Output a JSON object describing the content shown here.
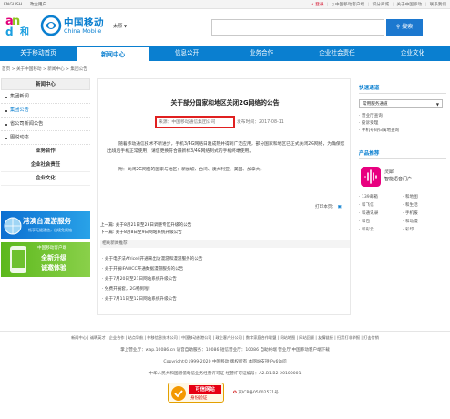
{
  "topbar": {
    "english": "ENGLISH",
    "portal": "政企用户",
    "login": "登录",
    "client": "中国移动客户端",
    "points": "积分商城",
    "about": "关于中国移动",
    "contact": "联系我们"
  },
  "header": {
    "brand_cn": "中国移动",
    "brand_en": "China Mobile",
    "region": "太原",
    "search_placeholder": "",
    "search_button": "搜索"
  },
  "nav": {
    "items": [
      {
        "label": "关于移动首页",
        "active": false
      },
      {
        "label": "新闻中心",
        "active": true
      },
      {
        "label": "信息公开",
        "active": false
      },
      {
        "label": "业务合作",
        "active": false
      },
      {
        "label": "企业社会责任",
        "active": false
      },
      {
        "label": "企业文化",
        "active": false
      }
    ]
  },
  "breadcrumb": "首页 > 关于中国移动 > 新闻中心 > 集团公告",
  "sidebar": {
    "title": "新闻中心",
    "items": [
      {
        "label": "集团新闻",
        "active": false
      },
      {
        "label": "集团公告",
        "active": true
      },
      {
        "label": "省公司新闻公告",
        "active": false
      },
      {
        "label": "图说动态",
        "active": false
      }
    ],
    "plain": [
      "业务合作",
      "企业社会责任",
      "企业文化"
    ],
    "banner1": "港澳台漫游服务",
    "banner1_sub": "畅享无缝通信，出境免烦恼",
    "banner2_a": "中国移动客户端",
    "banner2_b": "全新升级",
    "banner2_c": "诚邀体验"
  },
  "article": {
    "title": "关于部分国家和地区关闭2G网络的公告",
    "source": "来源：中国移动通信集团公司",
    "date": "发布时间：2017-08-11",
    "para1": "随着移动通信技术不断进步，手机3/4G网络日趋成熟并得到广泛应用，部分国家和地区已正式关闭2G网络，为确保您出境后手机正常使用，请您更换符合最新标3/4G网络制式的手机终端使用。",
    "para2": "附：关闭2G网络的国家与地区：新加坡、台湾、澳大利亚、美国、加拿大。",
    "print": "打印本页：",
    "prev": "上一篇: 关于8月21日至23日调整专区升级的公告",
    "next": "下一篇: 关于8月8日至9日网站系统升级公告",
    "related_title": "相关新闻推荐",
    "related": [
      "关于电子法Africell开通来出访漫游和漫游服务的公告",
      "关于开展IFAWCC开通数据漫游服务的公告",
      "关于7月20日至21日网站系统升级公告",
      "免费开展套，2G畅到啦！",
      "关于7月11日至12日网站系统升级公告"
    ]
  },
  "right": {
    "quick_title": "快速通道",
    "select": "常用服务通道",
    "links": [
      "营业厅查询",
      "投诉受理",
      "手机号码归属地查询"
    ],
    "product_title": "产品推荐",
    "product_name": "灵犀",
    "product_desc": "智能语音门户",
    "grid": [
      "139邮箱",
      "和地图",
      "和飞信",
      "和生活",
      "和通讯录",
      "手机报",
      "和包",
      "和动漫",
      "和彩云",
      "彩印"
    ]
  },
  "footer": {
    "line1": "新闻中心 | 诚聘英才 | 企业合作 | 站点导航 | 中移信息技术公司 | 中国移动香港公司 | 政企客户分公司 | 数字家庭合作联盟 | 网站地图 | 网站回顾 | 友情链接 | 扫黑打非举报 | 打击传销",
    "line2": "掌上营业厅：wap.10086.cn 语音自助服务：10086 短信营业厅：10086 自助终端 营业厅 中国移动客户端下载",
    "line3": "Copyright©1999-2020  中国移动  版权所有  本网站支持IPv6访问",
    "line4": "中华人民共和国增值电信业务经营许可证  经营许可证编号：A2.B1.B2-20100001",
    "trust_a": "可信网站",
    "trust_b": "身份验证",
    "icp": "京ICP备05002571号"
  },
  "colors": {
    "brand_blue": "#0a7fd0",
    "highlight_red": "#e02020",
    "and_green": "#8dc21f"
  }
}
